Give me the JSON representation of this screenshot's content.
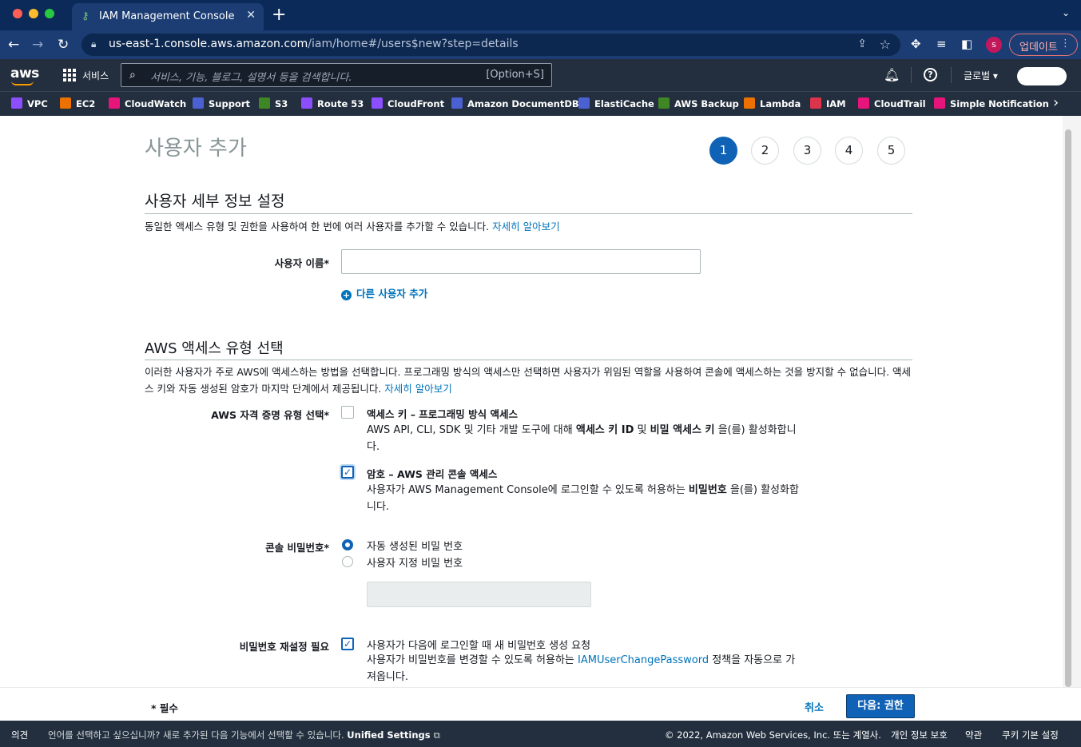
{
  "browser": {
    "tab_title": "IAM Management Console",
    "new_tab_label": "+",
    "url_host": "us-east-1.console.aws.amazon.com",
    "url_path": "/iam/home#/users$new?step=details",
    "profile_initial": "s",
    "update_label": "업데이트"
  },
  "aws_nav": {
    "logo": "aws",
    "services_label": "서비스",
    "search_placeholder": "서비스, 기능, 블로그, 설명서 등을 검색합니다.",
    "search_shortcut": "[Option+S]",
    "region_label": "글로벌 ▾"
  },
  "favorites": [
    {
      "label": "VPC",
      "color": "#8c4fff"
    },
    {
      "label": "EC2",
      "color": "#ed7100"
    },
    {
      "label": "CloudWatch",
      "color": "#e7157b"
    },
    {
      "label": "Support",
      "color": "#4b61d1"
    },
    {
      "label": "S3",
      "color": "#3f8624"
    },
    {
      "label": "Route 53",
      "color": "#8c4fff"
    },
    {
      "label": "CloudFront",
      "color": "#8c4fff"
    },
    {
      "label": "Amazon DocumentDB",
      "color": "#4b61d1"
    },
    {
      "label": "ElastiCache",
      "color": "#4b61d1"
    },
    {
      "label": "AWS Backup",
      "color": "#3f8624"
    },
    {
      "label": "Lambda",
      "color": "#ed7100"
    },
    {
      "label": "IAM",
      "color": "#dd344c"
    },
    {
      "label": "CloudTrail",
      "color": "#e7157b"
    },
    {
      "label": "Simple Notification Ser",
      "color": "#e7157b"
    }
  ],
  "page": {
    "title": "사용자 추가",
    "steps": [
      "1",
      "2",
      "3",
      "4",
      "5"
    ],
    "active_step": "1",
    "details": {
      "heading": "사용자 세부 정보 설정",
      "description": "동일한 액세스 유형 및 권한을 사용하여 한 번에 여러 사용자를 추가할 수 있습니다. ",
      "learn_more": "자세히 알아보기",
      "username_label": "사용자 이름*",
      "add_user_link": "다른 사용자 추가"
    },
    "access": {
      "heading": "AWS 액세스 유형 선택",
      "description": "이러한 사용자가 주로 AWS에 액세스하는 방법을 선택합니다. 프로그래밍 방식의 액세스만 선택하면 사용자가 위임된 역할을 사용하여 콘솔에 액세스하는 것을 방지할 수 없습니다. 액세스 키와 자동 생성된 암호가 마지막 단계에서 제공됩니다. ",
      "learn_more": "자세히 알아보기",
      "credential_label": "AWS 자격 증명 유형 선택*",
      "opt1_title": "액세스 키 – 프로그래밍 방식 액세스",
      "opt1_desc_a": "AWS API, CLI, SDK 및 기타 개발 도구에 대해 ",
      "opt1_desc_b": "액세스 키 ID",
      "opt1_desc_c": " 및 ",
      "opt1_desc_d": "비밀 액세스 키",
      "opt1_desc_e": " 을(를) 활성화합니다.",
      "opt1_checked": false,
      "opt2_title": "암호 – AWS 관리 콘솔 액세스",
      "opt2_desc_a": "사용자가 AWS Management Console에 로그인할 수 있도록 허용하는 ",
      "opt2_desc_b": "비밀번호",
      "opt2_desc_c": " 을(를) 활성화합니다.",
      "opt2_checked": true
    },
    "password": {
      "label": "콘솔 비밀번호*",
      "auto_label": "자동 생성된 비밀 번호",
      "custom_label": "사용자 지정 비밀 번호",
      "selected": "auto"
    },
    "reset": {
      "label": "비밀번호 재설정 필요",
      "title": "사용자가 다음에 로그인할 때 새 비밀번호 생성 요청",
      "desc_a": "사용자가 비밀번호를 변경할 수 있도록 허용하는 ",
      "desc_link": "IAMUserChangePassword",
      "desc_b": " 정책을 자동으로 가져옵니다.",
      "checked": true
    }
  },
  "actions": {
    "required_note": "* 필수",
    "cancel_label": "취소",
    "next_label": "다음: 권한"
  },
  "footer": {
    "feedback": "의견",
    "language_msg": "언어를 선택하고 싶으십니까? 새로 추가된 다음 기능에서 선택할 수 있습니다. ",
    "unified_settings": "Unified Settings",
    "copyright": "© 2022, Amazon Web Services, Inc. 또는 계열사.",
    "privacy": "개인 정보 보호",
    "terms": "약관",
    "cookies": "쿠키 기본 설정"
  }
}
